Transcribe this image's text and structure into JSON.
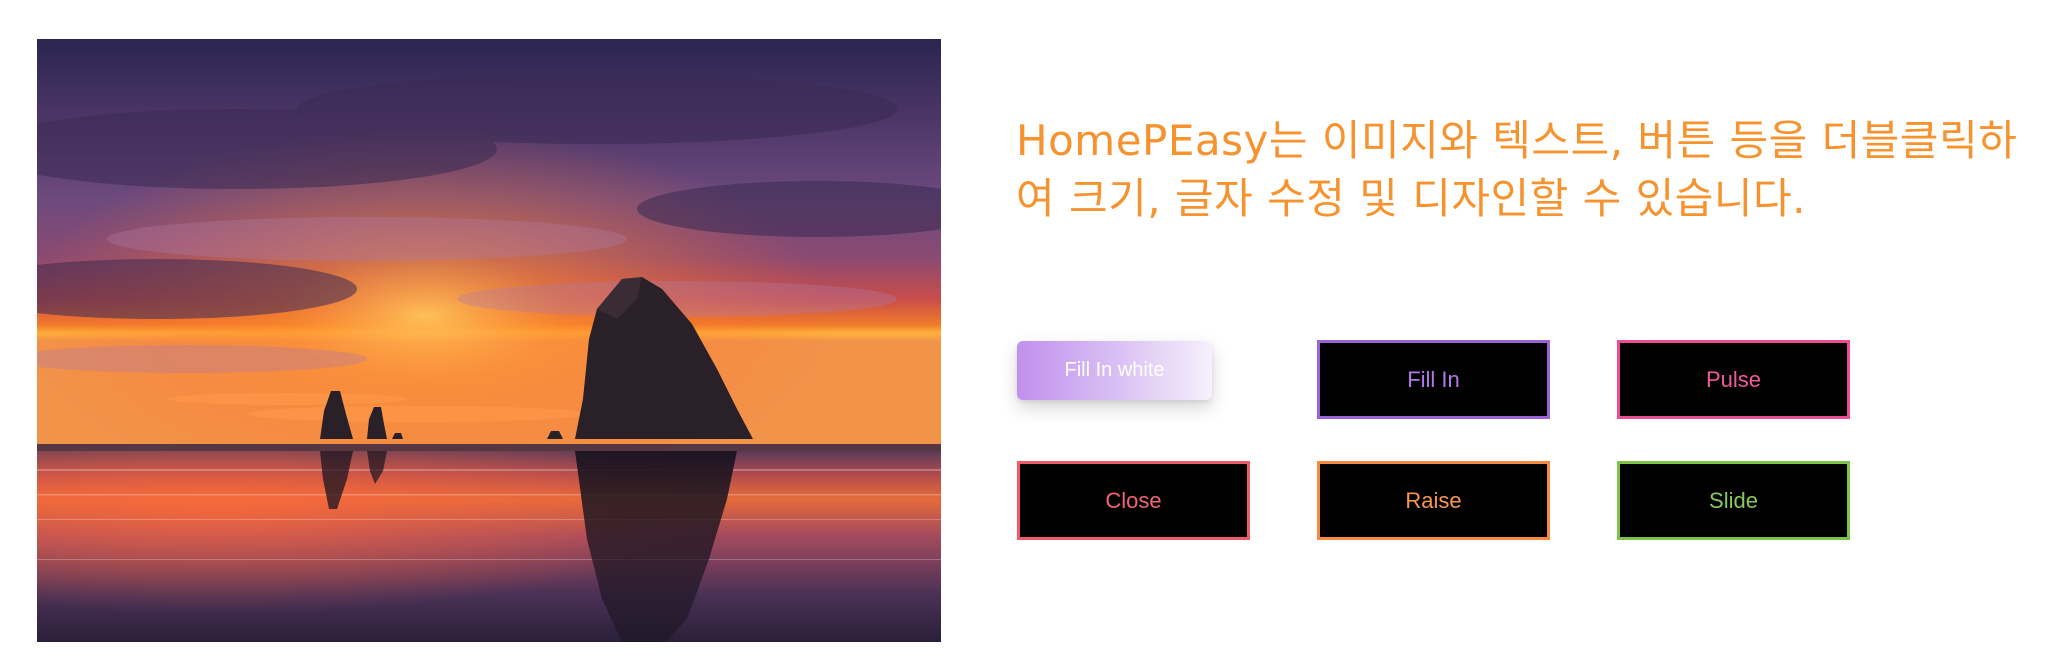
{
  "image": {
    "alt": "Sunset over beach with sea stacks"
  },
  "headline": {
    "text": "HomePEasy는 이미지와 텍스트, 버튼 등을 더블클릭하여 크기, 글자 수정 및 디자인할 수 있습니다."
  },
  "buttons": [
    {
      "label": "Fill In white",
      "style": "gradient",
      "border_color": "#ffffff",
      "text_color": "#ffffff"
    },
    {
      "label": "Fill In",
      "style": "outline",
      "border_color": "#9c63d6",
      "text_color": "#b178e8"
    },
    {
      "label": "Pulse",
      "style": "outline",
      "border_color": "#ec4d91",
      "text_color": "#f1589b"
    },
    {
      "label": "Close",
      "style": "outline",
      "border_color": "#ef5a6a",
      "text_color": "#f26473"
    },
    {
      "label": "Raise",
      "style": "outline",
      "border_color": "#f78a43",
      "text_color": "#f89550"
    },
    {
      "label": "Slide",
      "style": "outline",
      "border_color": "#7ec24a",
      "text_color": "#87c957"
    }
  ],
  "colors": {
    "headline": "#f7932f",
    "button_background": "#000000",
    "page_background": "#ffffff"
  }
}
